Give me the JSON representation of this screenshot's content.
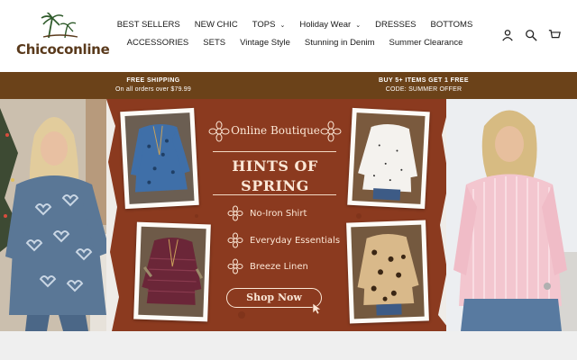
{
  "brand": {
    "name": "Chicoconline"
  },
  "nav": {
    "row1": [
      {
        "label": "BEST SELLERS",
        "dropdown": false
      },
      {
        "label": "NEW CHIC",
        "dropdown": false
      },
      {
        "label": "TOPS",
        "dropdown": true
      },
      {
        "label": "Holiday Wear",
        "dropdown": true
      },
      {
        "label": "DRESSES",
        "dropdown": false
      },
      {
        "label": "BOTTOMS",
        "dropdown": false
      }
    ],
    "row2": [
      {
        "label": "ACCESSORIES"
      },
      {
        "label": "SETS"
      },
      {
        "label": "Vintage Style"
      },
      {
        "label": "Stunning in Denim"
      },
      {
        "label": "Summer Clearance"
      }
    ]
  },
  "header_icons": [
    "account-icon",
    "search-icon",
    "cart-icon"
  ],
  "announcement": {
    "left": {
      "line1": "FREE SHIPPING",
      "line2": "On all orders over $79.99"
    },
    "right": {
      "line1": "BUY 5+ ITEMS GET 1 FREE",
      "line2": "CODE: SUMMER OFFER"
    }
  },
  "hero": {
    "boutique": "Online Boutique",
    "headline_1": "HINTS OF",
    "headline_2": "SPRING",
    "features": [
      "No-Iron Shirt",
      "Everyday Essentials",
      "Breeze Linen"
    ],
    "cta": "Shop Now"
  },
  "colors": {
    "announcement_bg": "#6b4219",
    "hero_rust": "#8b3a1f",
    "hero_text": "#fbe7d6",
    "logo_brown": "#5a3a1c"
  }
}
